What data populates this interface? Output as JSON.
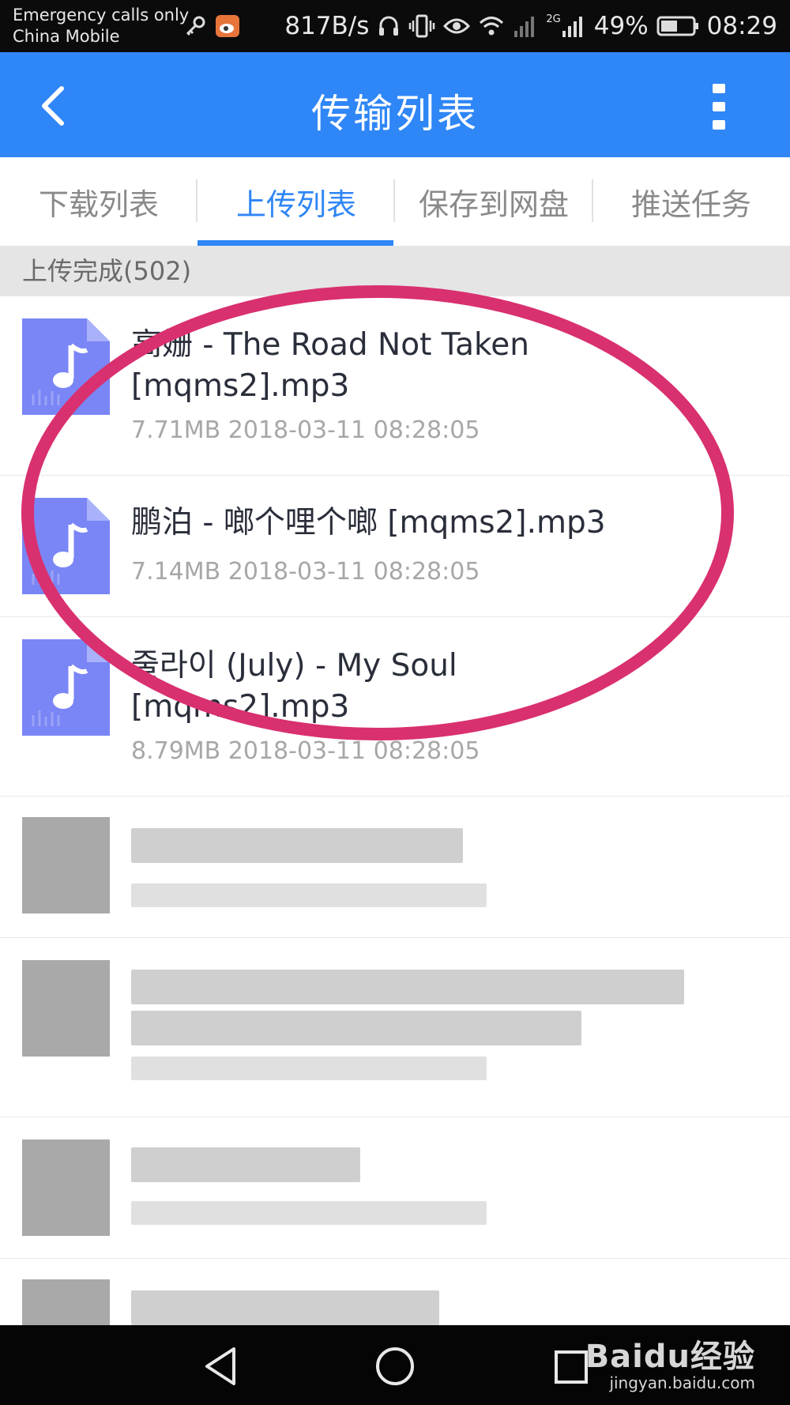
{
  "status_bar": {
    "line1": "Emergency calls only",
    "line2": "China Mobile",
    "speed": "817B/s",
    "net_tag": "2G",
    "battery": "49%",
    "time": "08:29"
  },
  "header": {
    "title": "传输列表",
    "back_icon": "chevron-left-icon",
    "more_icon": "more-vertical-icon",
    "color": "#2f86f6"
  },
  "tabs": [
    {
      "label": "下载列表",
      "active": false
    },
    {
      "label": "上传列表",
      "active": true
    },
    {
      "label": "保存到网盘",
      "active": false
    },
    {
      "label": "推送任务",
      "active": false
    }
  ],
  "section": {
    "label": "上传完成(502)"
  },
  "files": [
    {
      "name_line1": "高姗 - The Road Not Taken",
      "name_line2": "[mqms2].mp3",
      "meta": "7.71MB 2018-03-11 08:28:05",
      "icon": "music-file-icon"
    },
    {
      "name_line1": "鹏泊 - 啷个哩个啷 [mqms2].mp3",
      "name_line2": "",
      "meta": "7.14MB 2018-03-11 08:28:05",
      "icon": "music-file-icon"
    },
    {
      "name_line1": "줄라이 (July) - My Soul",
      "name_line2": "[mqms2].mp3",
      "meta": "8.79MB 2018-03-11 08:28:05",
      "icon": "music-file-icon"
    }
  ],
  "annotation_color": "#d9306f",
  "watermark": {
    "brand": "Baidu经验",
    "url": "jingyan.baidu.com"
  }
}
